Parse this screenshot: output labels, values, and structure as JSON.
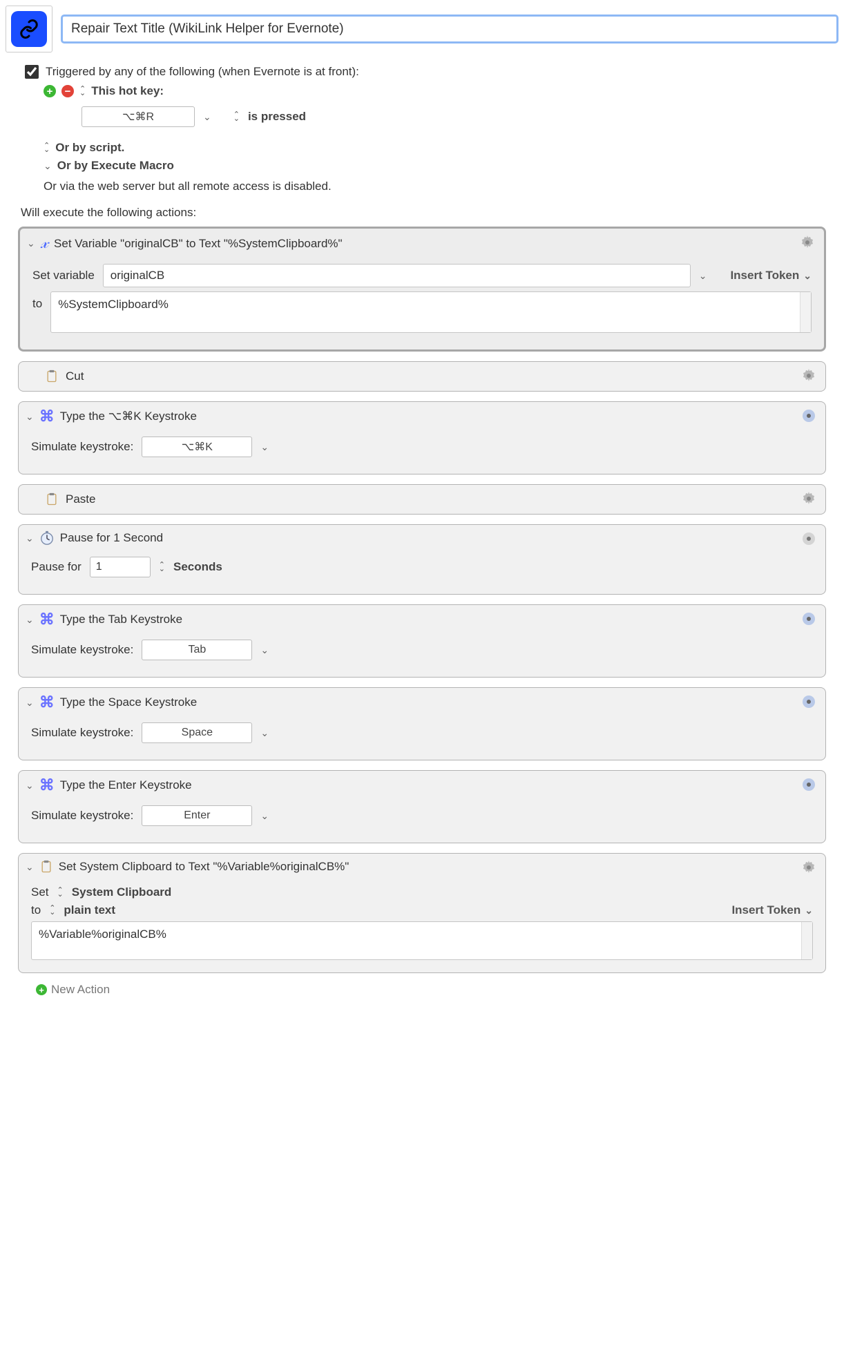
{
  "macro": {
    "title": "Repair Text Title (WikiLink Helper for Evernote)"
  },
  "trigger": {
    "checkbox_label": "Triggered by any of the following (when Evernote is at front):",
    "hotkey_label": "This hot key:",
    "hotkey_value": "⌥⌘R",
    "is_pressed": "is pressed",
    "or_script": "Or by script.",
    "or_execute_macro": "Or by Execute Macro",
    "web_server_note": "Or via the web server but all remote access is disabled."
  },
  "section_label": "Will execute the following actions:",
  "actions": {
    "set_var": {
      "title": "Set Variable \"originalCB\" to Text \"%SystemClipboard%\"",
      "set_variable_label": "Set variable",
      "variable_name": "originalCB",
      "insert_token": "Insert Token",
      "to_label": "to",
      "to_value": "%SystemClipboard%"
    },
    "cut": {
      "title": "Cut"
    },
    "type_cmdk": {
      "title": "Type the ⌥⌘K Keystroke",
      "sim_label": "Simulate keystroke:",
      "value": "⌥⌘K"
    },
    "paste": {
      "title": "Paste"
    },
    "pause": {
      "title": "Pause for 1 Second",
      "pause_label": "Pause for",
      "value": "1",
      "unit": "Seconds"
    },
    "type_tab": {
      "title": "Type the Tab Keystroke",
      "sim_label": "Simulate keystroke:",
      "value": "Tab"
    },
    "type_space": {
      "title": "Type the Space Keystroke",
      "sim_label": "Simulate keystroke:",
      "value": "Space"
    },
    "type_enter": {
      "title": "Type the Enter Keystroke",
      "sim_label": "Simulate keystroke:",
      "value": "Enter"
    },
    "set_clipboard": {
      "title": "Set System Clipboard to Text \"%Variable%originalCB%\"",
      "set_label": "Set",
      "target": "System Clipboard",
      "to_label": "to",
      "format": "plain text",
      "insert_token": "Insert Token",
      "value": "%Variable%originalCB%"
    }
  },
  "new_action": "New Action"
}
